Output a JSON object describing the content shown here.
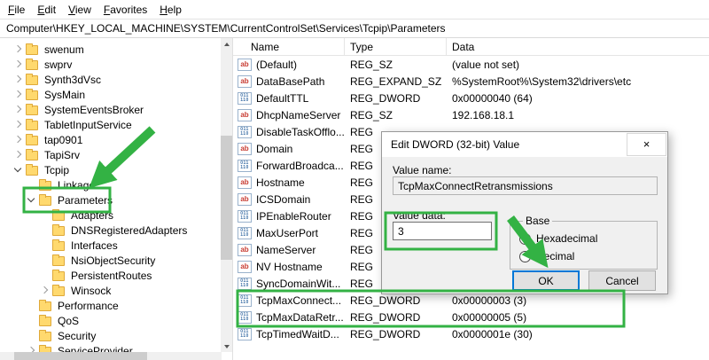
{
  "window": {
    "menu_items": [
      "File",
      "Edit",
      "View",
      "Favorites",
      "Help"
    ],
    "address": "Computer\\HKEY_LOCAL_MACHINE\\SYSTEM\\CurrentControlSet\\Services\\Tcpip\\Parameters"
  },
  "tree": {
    "items": [
      {
        "label": "swenum",
        "level": 0,
        "expander": "collapsed"
      },
      {
        "label": "swprv",
        "level": 0,
        "expander": "collapsed"
      },
      {
        "label": "Synth3dVsc",
        "level": 0,
        "expander": "collapsed"
      },
      {
        "label": "SysMain",
        "level": 0,
        "expander": "collapsed"
      },
      {
        "label": "SystemEventsBroker",
        "level": 0,
        "expander": "collapsed"
      },
      {
        "label": "TabletInputService",
        "level": 0,
        "expander": "collapsed"
      },
      {
        "label": "tap0901",
        "level": 0,
        "expander": "collapsed"
      },
      {
        "label": "TapiSrv",
        "level": 0,
        "expander": "collapsed"
      },
      {
        "label": "Tcpip",
        "level": 0,
        "expander": "expanded"
      },
      {
        "label": "Linkage",
        "level": 1,
        "expander": "none"
      },
      {
        "label": "Parameters",
        "level": 1,
        "expander": "expanded"
      },
      {
        "label": "Adapters",
        "level": 2,
        "expander": "none"
      },
      {
        "label": "DNSRegisteredAdapters",
        "level": 2,
        "expander": "none"
      },
      {
        "label": "Interfaces",
        "level": 2,
        "expander": "none"
      },
      {
        "label": "NsiObjectSecurity",
        "level": 2,
        "expander": "none"
      },
      {
        "label": "PersistentRoutes",
        "level": 2,
        "expander": "none"
      },
      {
        "label": "Winsock",
        "level": 2,
        "expander": "collapsed"
      },
      {
        "label": "Performance",
        "level": 1,
        "expander": "none"
      },
      {
        "label": "QoS",
        "level": 1,
        "expander": "none"
      },
      {
        "label": "Security",
        "level": 1,
        "expander": "none"
      },
      {
        "label": "ServiceProvider",
        "level": 1,
        "expander": "collapsed"
      }
    ]
  },
  "list": {
    "columns": [
      "Name",
      "Type",
      "Data"
    ],
    "rows": [
      {
        "name": "(Default)",
        "icon": "string",
        "type": "REG_SZ",
        "data": "(value not set)"
      },
      {
        "name": "DataBasePath",
        "icon": "string",
        "type": "REG_EXPAND_SZ",
        "data": "%SystemRoot%\\System32\\drivers\\etc"
      },
      {
        "name": "DefaultTTL",
        "icon": "dword",
        "type": "REG_DWORD",
        "data": "0x00000040 (64)"
      },
      {
        "name": "DhcpNameServer",
        "icon": "string",
        "type": "REG_SZ",
        "data": "192.168.18.1"
      },
      {
        "name": "DisableTaskOfflo...",
        "icon": "dword",
        "type": "REG",
        "data": ""
      },
      {
        "name": "Domain",
        "icon": "string",
        "type": "REG",
        "data": ""
      },
      {
        "name": "ForwardBroadca...",
        "icon": "dword",
        "type": "REG",
        "data": ""
      },
      {
        "name": "Hostname",
        "icon": "string",
        "type": "REG",
        "data": ""
      },
      {
        "name": "ICSDomain",
        "icon": "string",
        "type": "REG",
        "data": ""
      },
      {
        "name": "IPEnableRouter",
        "icon": "dword",
        "type": "REG",
        "data": ""
      },
      {
        "name": "MaxUserPort",
        "icon": "dword",
        "type": "REG",
        "data": ""
      },
      {
        "name": "NameServer",
        "icon": "string",
        "type": "REG",
        "data": ""
      },
      {
        "name": "NV Hostname",
        "icon": "string",
        "type": "REG",
        "data": ""
      },
      {
        "name": "SyncDomainWit...",
        "icon": "dword",
        "type": "REG",
        "data": ""
      },
      {
        "name": "TcpMaxConnect...",
        "icon": "dword",
        "type": "REG_DWORD",
        "data": "0x00000003 (3)"
      },
      {
        "name": "TcpMaxDataRetr...",
        "icon": "dword",
        "type": "REG_DWORD",
        "data": "0x00000005 (5)"
      },
      {
        "name": "TcpTimedWaitD...",
        "icon": "dword",
        "type": "REG_DWORD",
        "data": "0x0000001e (30)"
      }
    ]
  },
  "dialog": {
    "title": "Edit DWORD (32-bit) Value",
    "close_glyph": "×",
    "value_name_label": "Value name:",
    "value_name": "TcpMaxConnectRetransmissions",
    "value_data_label": "Value data:",
    "value_data": "3",
    "base_label": "Base",
    "radio_hex": "Hexadecimal",
    "radio_dec": "Decimal",
    "ok_label": "OK",
    "cancel_label": "Cancel"
  },
  "icons": {
    "string_value_glyph": "ab",
    "dword_value_top": "011",
    "dword_value_bottom": "110"
  },
  "colors": {
    "annotation_green": "#33b244",
    "folder_yellow": "#ffd96e",
    "default_button_border": "#0078d7"
  }
}
